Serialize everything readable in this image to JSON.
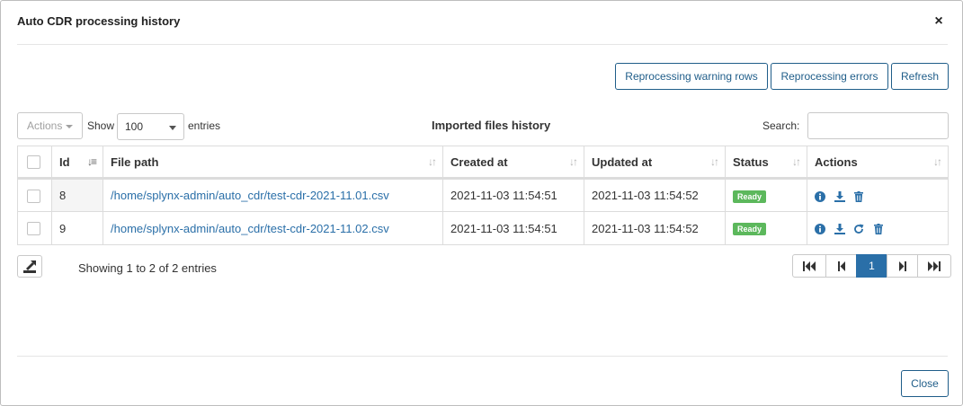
{
  "dialog": {
    "title": "Auto CDR processing history",
    "close_icon": "×",
    "close_button": "Close"
  },
  "toolbar": {
    "reprocess_warning": "Reprocessing warning rows",
    "reprocess_errors": "Reprocessing errors",
    "refresh": "Refresh"
  },
  "controls": {
    "actions_label": "Actions",
    "show_label": "Show",
    "page_size": "100",
    "entries_label": "entries",
    "table_title": "Imported files history",
    "search_label": "Search:",
    "search_value": ""
  },
  "table": {
    "columns": [
      "Id",
      "File path",
      "Created at",
      "Updated at",
      "Status",
      "Actions"
    ],
    "rows": [
      {
        "id": "8",
        "file_path": "/home/splynx-admin/auto_cdr/test-cdr-2021-11.01.csv",
        "created_at": "2021-11-03 11:54:51",
        "updated_at": "2021-11-03 11:54:52",
        "status": "Ready",
        "actions": [
          "info-icon",
          "download-icon",
          "delete-icon"
        ]
      },
      {
        "id": "9",
        "file_path": "/home/splynx-admin/auto_cdr/test-cdr-2021-11.02.csv",
        "created_at": "2021-11-03 11:54:51",
        "updated_at": "2021-11-03 11:54:52",
        "status": "Ready",
        "actions": [
          "info-icon",
          "download-icon",
          "reprocess-icon",
          "delete-icon"
        ]
      }
    ]
  },
  "footer": {
    "info": "Showing 1 to 2 of 2 entries",
    "current_page": "1"
  },
  "colors": {
    "primary": "#1f5d89",
    "link": "#2a6fa8",
    "status_ready": "#5cb85c"
  }
}
